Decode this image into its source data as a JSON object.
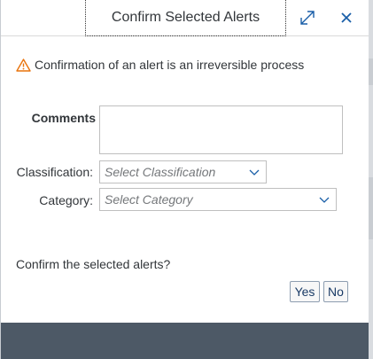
{
  "dialog": {
    "title": "Confirm Selected Alerts",
    "expand_icon": "expand-icon",
    "close_icon": "close-icon"
  },
  "warning": {
    "icon": "warning-triangle-icon",
    "icon_color": "#e9730c",
    "text": "Confirmation of an alert is an irreversible process"
  },
  "form": {
    "comments_label": "Comments",
    "comments_value": "",
    "classification_label": "Classification:",
    "classification_placeholder": "Select Classification",
    "category_label": "Category:",
    "category_placeholder": "Select Category"
  },
  "confirm": {
    "question": "Confirm the selected alerts?",
    "yes_label": "Yes",
    "no_label": "No"
  },
  "colors": {
    "accent": "#1a5fa8",
    "footer": "#4d5966"
  }
}
